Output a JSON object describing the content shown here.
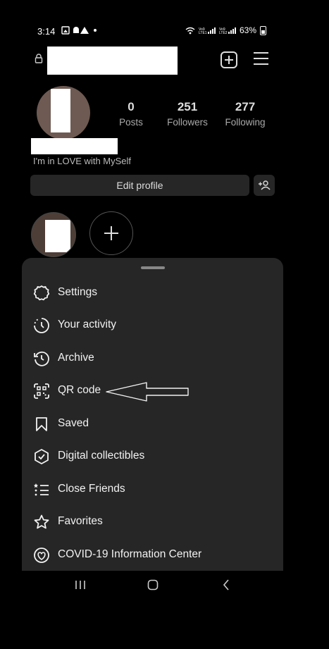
{
  "status_bar": {
    "time": "3:14",
    "battery": "63%",
    "network_label_1": "Vo9\nLTE1",
    "network_label_2": "Vo9\nLTE2"
  },
  "profile": {
    "stats": [
      {
        "value": "0",
        "label": "Posts"
      },
      {
        "value": "251",
        "label": "Followers"
      },
      {
        "value": "277",
        "label": "Following"
      }
    ],
    "bio": "I'm in LOVE with MySelf",
    "edit_profile_label": "Edit profile"
  },
  "menu": {
    "items": [
      {
        "label": "Settings",
        "icon": "settings-icon"
      },
      {
        "label": "Your activity",
        "icon": "activity-icon"
      },
      {
        "label": "Archive",
        "icon": "archive-icon"
      },
      {
        "label": "QR code",
        "icon": "qr-code-icon"
      },
      {
        "label": "Saved",
        "icon": "bookmark-icon"
      },
      {
        "label": "Digital collectibles",
        "icon": "collectibles-icon"
      },
      {
        "label": "Close Friends",
        "icon": "close-friends-icon"
      },
      {
        "label": "Favorites",
        "icon": "star-icon"
      },
      {
        "label": "COVID-19 Information Center",
        "icon": "covid-info-icon"
      }
    ]
  },
  "colors": {
    "sheet_bg": "#262626",
    "text": "#f2f2f2",
    "background": "#000000"
  }
}
